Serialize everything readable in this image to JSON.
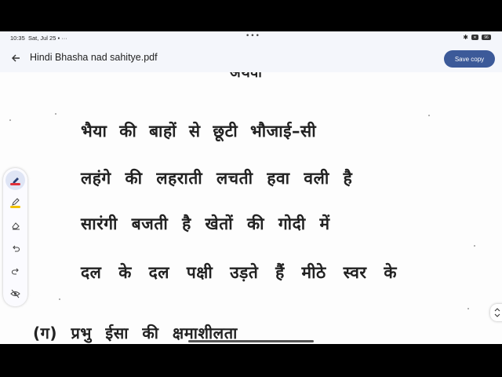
{
  "status_bar": {
    "time": "10:35",
    "date": "Sat, Jul 25",
    "battery": "96"
  },
  "app_bar": {
    "title": "Hindi Bhasha nad sahitye.pdf",
    "save_label": "Save copy",
    "accent_color": "#3c5a99"
  },
  "document": {
    "lines": [
      "अथवा",
      "भैया की बाहों से छूटी भौजाई–सी",
      "लहंगे की लहराती लचती हवा वली है",
      "सारंगी बजती है खेतों की गोदी में",
      "दल के दल पक्षी उड़ते हैं मीठे स्वर के",
      "(ग) प्रभु ईसा की क्षमाशीलता"
    ]
  },
  "toolbar": {
    "tools": [
      "pen-icon",
      "highlighter-icon",
      "eraser-icon",
      "undo-icon",
      "redo-icon",
      "hide-annotations-icon"
    ],
    "pen_color": "#e0303a",
    "highlighter_color": "#f2c200"
  }
}
